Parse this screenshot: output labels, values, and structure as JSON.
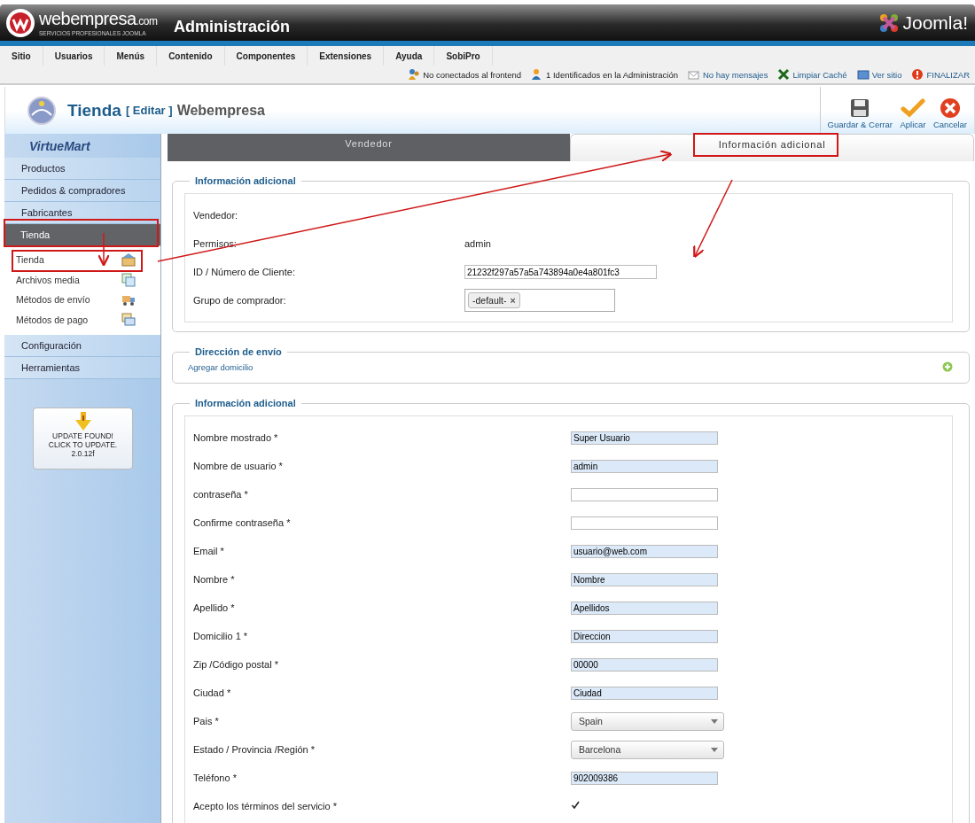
{
  "header": {
    "brand": "webempresa",
    "brand_suffix": ".com",
    "tagline": "SERVICIOS PROFESIONALES JOOMLA",
    "title": "Administración",
    "logo": "Joomla!"
  },
  "menu": [
    "Sitio",
    "Usuarios",
    "Menús",
    "Contenido",
    "Componentes",
    "Extensiones",
    "Ayuda",
    "SobiPro"
  ],
  "status": [
    {
      "kind": "users",
      "text": "No conectados al frontend",
      "link": false
    },
    {
      "kind": "admins",
      "text": "1 Identificados en la Administración",
      "link": false
    },
    {
      "kind": "mail",
      "text": "No hay mensajes",
      "link": true
    },
    {
      "kind": "cache",
      "text": "Limpiar Caché",
      "link": true
    },
    {
      "kind": "site",
      "text": "Ver sitio",
      "link": true
    },
    {
      "kind": "logout",
      "text": "FINALIZAR",
      "link": true
    }
  ],
  "page_title": {
    "title": "Tienda",
    "action": "[ Editar ]",
    "subtitle": "Webempresa"
  },
  "toolbar": [
    {
      "kind": "save",
      "label": "Guardar & Cerrar"
    },
    {
      "kind": "apply",
      "label": "Aplicar"
    },
    {
      "kind": "cancel",
      "label": "Cancelar"
    }
  ],
  "sidebar": {
    "logo": "VirtueMart",
    "items": [
      {
        "label": "Productos",
        "selected": false
      },
      {
        "label": "Pedidos & compradores",
        "selected": false
      },
      {
        "label": "Fabricantes",
        "selected": false
      },
      {
        "label": "Tienda",
        "selected": true,
        "children": [
          {
            "label": "Tienda",
            "kind": "shop",
            "selected": false
          },
          {
            "label": "Archivos media",
            "kind": "media",
            "selected": false
          },
          {
            "label": "Métodos de envío",
            "kind": "shipping",
            "selected": false
          },
          {
            "label": "Métodos de pago",
            "kind": "payment",
            "selected": false
          }
        ]
      },
      {
        "label": "Configuración",
        "selected": false
      },
      {
        "label": "Herramientas",
        "selected": false
      }
    ],
    "update": [
      "UPDATE FOUND!",
      "CLICK TO UPDATE.",
      "2.0.12f"
    ]
  },
  "tabs": [
    {
      "label": "Vendedor",
      "selected": false
    },
    {
      "label": "Información adicional",
      "selected": true
    }
  ],
  "vendor_section": {
    "legend": "Información adicional",
    "rows": [
      {
        "label": "Vendedor:",
        "kind": "none"
      },
      {
        "label": "Permisos:",
        "kind": "plain",
        "value": "admin"
      },
      {
        "label": "ID / Número de Cliente:",
        "kind": "input",
        "value": "21232f297a57a5a743894a0e4a801fc3"
      },
      {
        "label": "Grupo de comprador:",
        "kind": "chips",
        "value": "-default-",
        "remove": "×"
      }
    ]
  },
  "shipping_section": {
    "legend": "Dirección de envío",
    "link": "Agregar domicilio"
  },
  "user_section": {
    "legend": "Información adicional",
    "rows": [
      {
        "label": "Nombre mostrado *",
        "kind": "text",
        "value": "Super Usuario"
      },
      {
        "label": "Nombre de usuario *",
        "kind": "text",
        "value": "admin"
      },
      {
        "label": "contraseña *",
        "kind": "password"
      },
      {
        "label": "Confirme contraseña *",
        "kind": "password"
      },
      {
        "label": "Email *",
        "kind": "text",
        "value": "usuario@web.com"
      },
      {
        "label": "Nombre *",
        "kind": "text",
        "value": "Nombre"
      },
      {
        "label": "Apellido *",
        "kind": "text",
        "value": "Apellidos"
      },
      {
        "label": "Domicilio 1 *",
        "kind": "text",
        "value": "Direccion"
      },
      {
        "label": "Zip /Código postal *",
        "kind": "text",
        "value": "00000"
      },
      {
        "label": "Ciudad *",
        "kind": "text",
        "value": "Ciudad"
      },
      {
        "label": "Pais *",
        "kind": "select",
        "value": "Spain"
      },
      {
        "label": "Estado / Provincia /Región *",
        "kind": "select",
        "value": "Barcelona"
      },
      {
        "label": "Teléfono *",
        "kind": "text",
        "value": "902009386"
      },
      {
        "label": "Acepto los términos del servicio *",
        "kind": "checkbox",
        "checked": true
      }
    ]
  }
}
